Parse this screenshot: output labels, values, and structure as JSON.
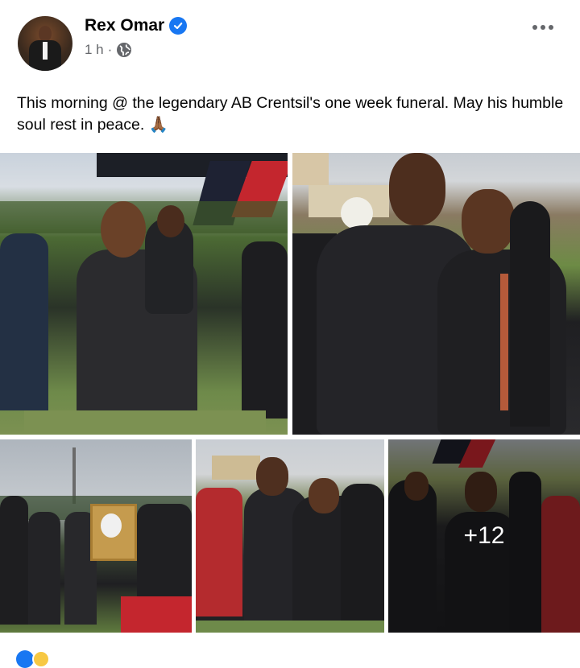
{
  "post": {
    "author": "Rex Omar",
    "time": "1 h",
    "separator": "·",
    "text": "This morning @ the legendary AB Crentsil's one week funeral. May his humble soul rest in peace. 🙏🏾",
    "more_photos": "+12"
  },
  "icons": {
    "verified": "verified-badge-icon",
    "globe": "globe-icon",
    "more": "more-options-icon",
    "pray": "folded-hands-emoji"
  },
  "colors": {
    "accent": "#1877f2",
    "meta_text": "#65676b",
    "text": "#050505"
  }
}
